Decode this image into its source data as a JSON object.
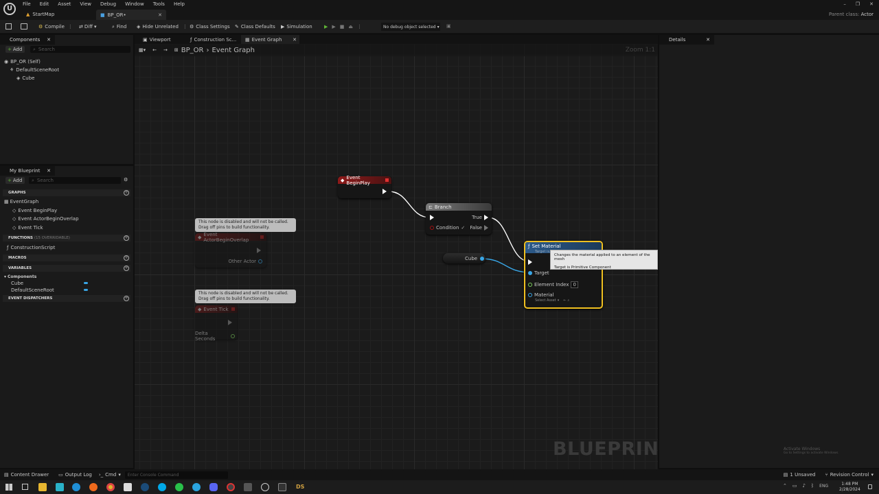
{
  "menu": [
    "File",
    "Edit",
    "Asset",
    "View",
    "Debug",
    "Window",
    "Tools",
    "Help"
  ],
  "tabs": [
    {
      "label": "StartMap"
    },
    {
      "label": "BP_OR•"
    }
  ],
  "parent_class": "Parent class:",
  "parent_value": "Actor",
  "toolbar": {
    "compile": "Compile",
    "diff": "Diff",
    "find": "Find",
    "hide_unrelated": "Hide Unrelated",
    "class_settings": "Class Settings",
    "class_defaults": "Class Defaults",
    "simulation": "Simulation",
    "debug_select": "No debug object selected"
  },
  "components": {
    "title": "Components",
    "add": "Add",
    "search_placeholder": "Search",
    "tree": [
      "BP_OR (Self)",
      "DefaultSceneRoot",
      "Cube"
    ]
  },
  "editor_tabs": [
    "Viewport",
    "Construction Sc...",
    "Event Graph"
  ],
  "breadcrumb": {
    "root": "BP_OR",
    "sep": "›",
    "current": "Event Graph"
  },
  "zoom": "Zoom 1:1",
  "details": {
    "title": "Details"
  },
  "my_blueprint": {
    "title": "My Blueprint",
    "add": "Add",
    "search_placeholder": "Search",
    "graphs_header": "GRAPHS",
    "event_graph": "EventGraph",
    "events": [
      "Event BeginPlay",
      "Event ActorBeginOverlap",
      "Event Tick"
    ],
    "functions_header": "FUNCTIONS",
    "functions_count": "(15 OVERRIDABLE)",
    "construction_script": "ConstructionScript",
    "macros_header": "MACROS",
    "variables_header": "VARIABLES",
    "components_group": "Components",
    "variables": [
      "Cube",
      "DefaultSceneRoot"
    ],
    "dispatchers_header": "EVENT DISPATCHERS"
  },
  "graph": {
    "begin_play": "Event BeginPlay",
    "branch": {
      "title": "Branch",
      "true": "True",
      "false": "False",
      "condition": "Condition"
    },
    "cube_ref": "Cube",
    "set_material": {
      "title": "Set Material",
      "subtitle": "Target is...",
      "target": "Target",
      "element_index": "Element Index",
      "element_value": "0",
      "material": "Material",
      "select_asset": "Select Asset"
    },
    "tooltip": {
      "line1": "Changes the material applied to an element of the mesh",
      "line2": "Target is Primitive Component"
    },
    "disabled_comment": "This node is disabled and will not be called.\nDrag off pins to build functionality.",
    "overlap": {
      "title": "Event ActorBeginOverlap",
      "pin": "Other Actor"
    },
    "tick": {
      "title": "Event Tick",
      "pin": "Delta Seconds"
    },
    "watermark": "BLUEPRINT"
  },
  "activate": {
    "line1": "Activate Windows",
    "line2": "Go to Settings to activate Windows."
  },
  "status": {
    "content_drawer": "Content Drawer",
    "output_log": "Output Log",
    "cmd": "Cmd",
    "console_placeholder": "Enter Console Command",
    "unsaved": "1 Unsaved",
    "revision": "Revision Control"
  },
  "taskbar": {
    "ds": "DS",
    "lang": "ENG",
    "time": "1:48 PM",
    "date": "2/28/2024"
  },
  "colors": {
    "accent_green": "#5fb336",
    "event_red": "#8e1a1a",
    "selection_yellow": "#f0c020",
    "pin_blue": "#39a6e6",
    "pin_green": "#7cd15c"
  }
}
